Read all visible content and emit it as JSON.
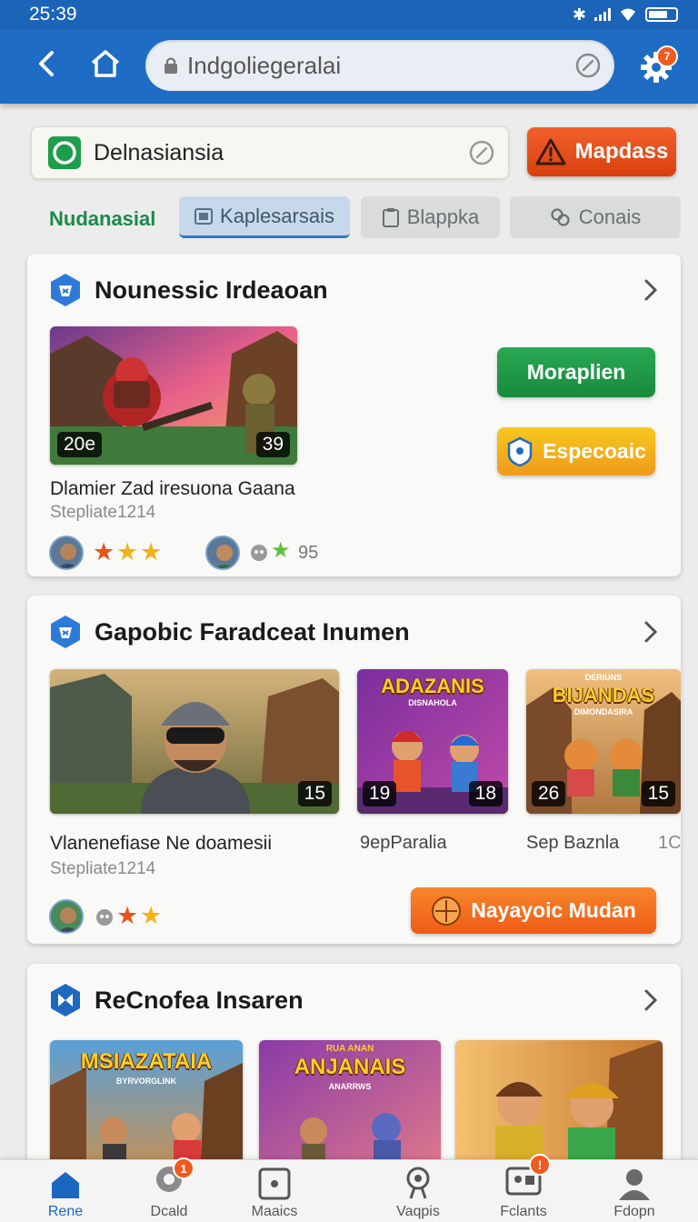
{
  "status_bar": {
    "time": "25:39"
  },
  "app_bar": {
    "url": "Indgoliegeralai",
    "settings_badge": "7"
  },
  "search": {
    "value": "Delnasiansia",
    "alert_button_label": "Mapdass"
  },
  "tabs": {
    "active_label": "Nudanasial",
    "items": [
      {
        "label": "Kaplesarsais"
      },
      {
        "label": "Blappka"
      },
      {
        "label": "Conais"
      }
    ]
  },
  "cards": [
    {
      "title": "Nounessic Irdeaoan",
      "thumb_left_number": "20e",
      "thumb_right_number": "39",
      "game_title": "Dlamier Zad iresuona Gaana",
      "game_sub": "Stepliate1214",
      "primary_button": "Moraplien",
      "secondary_button": "Especoaic",
      "rating_count": "95"
    },
    {
      "title": "Gapobic Faradceat Inumen",
      "thumbs": [
        {
          "number": "15"
        },
        {
          "number_left": "19",
          "number_right": "18",
          "banner": "ADAZANIS",
          "banner_sub": "DISNAHOLA"
        },
        {
          "number_left": "26",
          "number_right": "15",
          "banner_top": "DERIUNS",
          "banner": "BIJANDAS",
          "banner_sub": "DIMONDASIRA"
        }
      ],
      "game_title": "Vlanenefiase Ne doamesii",
      "game_sub": "Stepliate1214",
      "mini_titles": [
        "9epParalia",
        "Sep Baznla",
        "1C"
      ],
      "action_button": "Nayayoic Mudan"
    },
    {
      "title": "ReCnofea  Insaren",
      "thumbs": [
        {
          "banner": "MSIAZATAIA",
          "banner_sub": "BYRVORGLINK"
        },
        {
          "banner_top": "RUA ANAN",
          "banner": "ANJANAIS",
          "banner_sub": "ANARRWS"
        },
        {
          "banner": ""
        }
      ]
    }
  ],
  "bottom_nav": {
    "items": [
      {
        "label": "Rene"
      },
      {
        "label": "Dcald",
        "badge": "1"
      },
      {
        "label": "Maaics"
      },
      {
        "label": "Vaqpis"
      },
      {
        "label": "Fclants",
        "badge": "!"
      },
      {
        "label": "Fdopn"
      }
    ]
  },
  "colors": {
    "primary": "#1e6cc3",
    "accent_orange": "#f05a1e",
    "accent_green": "#1e9d4a",
    "accent_yellow": "#f2b21a"
  }
}
